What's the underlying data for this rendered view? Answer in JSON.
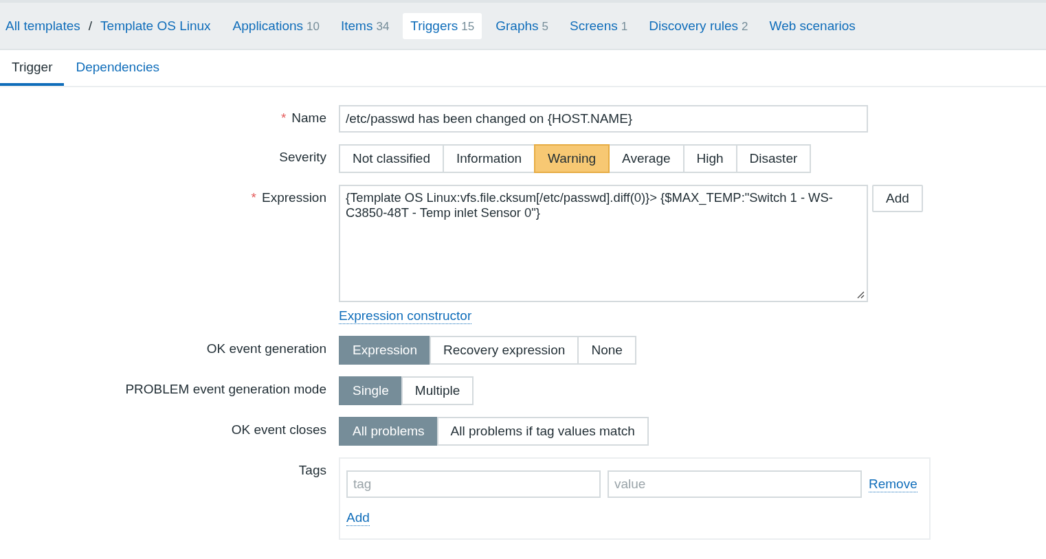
{
  "breadcrumbs": {
    "separator": "/",
    "items": [
      {
        "label": "All templates"
      },
      {
        "label": "Template OS Linux"
      }
    ]
  },
  "nav": [
    {
      "label": "Applications",
      "count": "10",
      "selected": false
    },
    {
      "label": "Items",
      "count": "34",
      "selected": false
    },
    {
      "label": "Triggers",
      "count": "15",
      "selected": true
    },
    {
      "label": "Graphs",
      "count": "5",
      "selected": false
    },
    {
      "label": "Screens",
      "count": "1",
      "selected": false
    },
    {
      "label": "Discovery rules",
      "count": "2",
      "selected": false
    },
    {
      "label": "Web scenarios",
      "selected": false
    }
  ],
  "tabs": [
    {
      "label": "Trigger",
      "selected": true
    },
    {
      "label": "Dependencies",
      "selected": false
    }
  ],
  "required_mark": "*",
  "form": [
    {
      "kind": "text",
      "label": "Name",
      "required": true,
      "value": "/etc/passwd has been changed on {HOST.NAME}"
    },
    {
      "kind": "severity",
      "label": "Severity",
      "required": false,
      "options": [
        {
          "label": "Not classified",
          "selected": false
        },
        {
          "label": "Information",
          "selected": false
        },
        {
          "label": "Warning",
          "selected": true
        },
        {
          "label": "Average",
          "selected": false
        },
        {
          "label": "High",
          "selected": false
        },
        {
          "label": "Disaster",
          "selected": false
        }
      ]
    },
    {
      "kind": "expression",
      "label": "Expression",
      "required": true,
      "value": "{Template OS Linux:vfs.file.cksum[/etc/passwd].diff(0)}> {$MAX_TEMP:\"Switch 1 - WS-C3850-48T - Temp inlet Sensor 0\"}",
      "button": "Add",
      "link": "Expression constructor"
    },
    {
      "kind": "toggle",
      "label": "OK event generation",
      "required": false,
      "options": [
        {
          "label": "Expression",
          "selected": true
        },
        {
          "label": "Recovery expression",
          "selected": false
        },
        {
          "label": "None",
          "selected": false
        }
      ]
    },
    {
      "kind": "toggle",
      "label": "PROBLEM event generation mode",
      "required": false,
      "options": [
        {
          "label": "Single",
          "selected": true
        },
        {
          "label": "Multiple",
          "selected": false
        }
      ]
    },
    {
      "kind": "toggle",
      "label": "OK event closes",
      "required": false,
      "options": [
        {
          "label": "All problems",
          "selected": true
        },
        {
          "label": "All problems if tag values match",
          "selected": false
        }
      ]
    },
    {
      "kind": "tags",
      "label": "Tags",
      "required": false,
      "tag_placeholder": "tag",
      "value_placeholder": "value",
      "remove": "Remove",
      "add": "Add"
    }
  ]
}
